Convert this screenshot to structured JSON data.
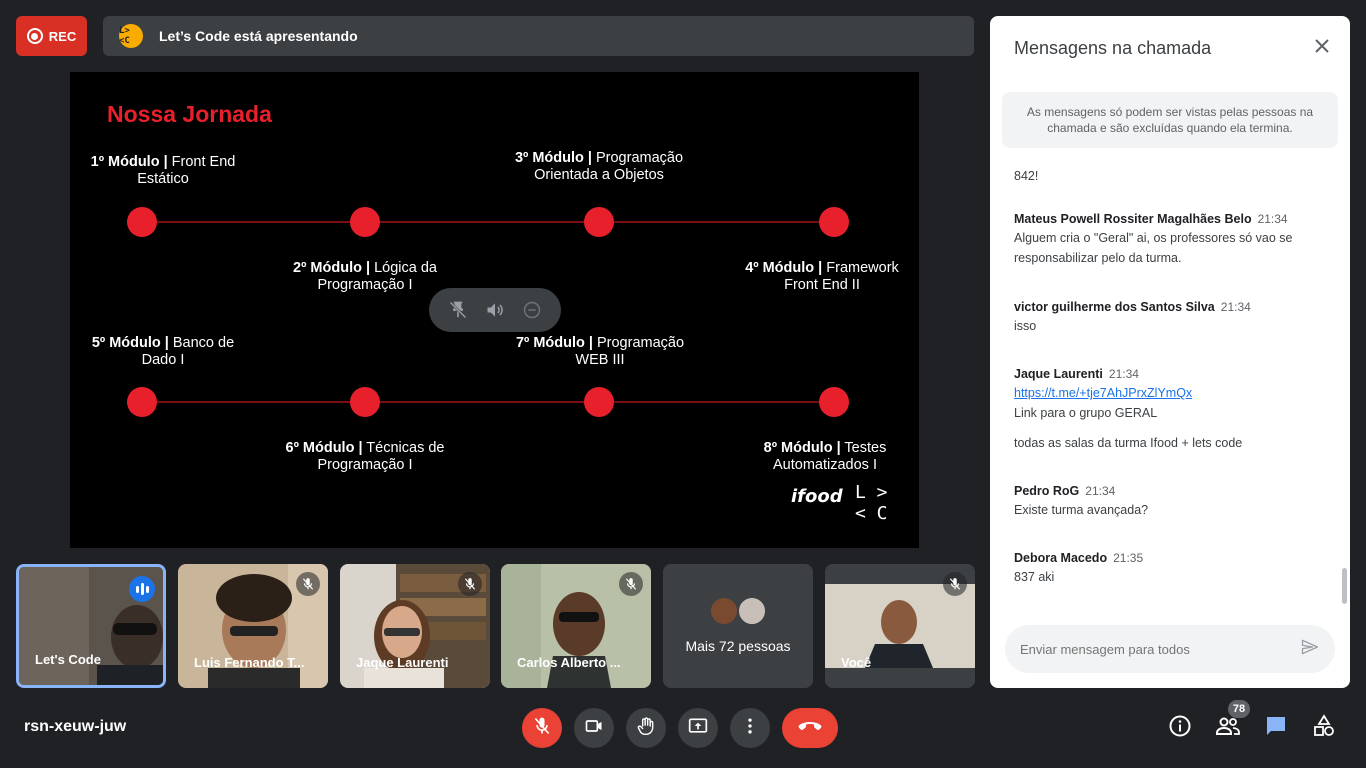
{
  "top_bar": {
    "rec_label": "REC",
    "presenting_text": "Let’s Code está apresentando",
    "presenter_logo": "L> <C"
  },
  "slide": {
    "title": "Nossa Jornada",
    "modules": [
      {
        "bold": "1º Módulo |",
        "rest": " Front End Estático"
      },
      {
        "bold": "2º Módulo |",
        "rest": " Lógica da Programação I"
      },
      {
        "bold": "3º Módulo |",
        "rest": " Programação Orientada a Objetos"
      },
      {
        "bold": "4º Módulo |",
        "rest": " Framework Front End II"
      },
      {
        "bold": "5º Módulo |",
        "rest": " Banco de Dado I"
      },
      {
        "bold": "6º Módulo |",
        "rest": " Técnicas de Programação I"
      },
      {
        "bold": "7º Módulo |",
        "rest": " Programação WEB III"
      },
      {
        "bold": "8º Módulo |",
        "rest": " Testes Automatizados I"
      }
    ],
    "brand_ifood": "ifood",
    "brand_lc_top": "L >",
    "brand_lc_bottom": "< C",
    "accent": "#e8202b"
  },
  "participants": [
    {
      "name": "Let's Code",
      "speaking": true
    },
    {
      "name": "Luis Fernando T...",
      "muted": true
    },
    {
      "name": "Jaque Laurenti",
      "muted": true
    },
    {
      "name": "Carlos Alberto ...",
      "muted": true
    },
    {
      "name": "Mais 72 pessoas"
    },
    {
      "name": "Você",
      "muted": true
    }
  ],
  "bottom_bar": {
    "meeting_code": "rsn-xeuw-juw",
    "people_count": "78"
  },
  "chat": {
    "title": "Mensagens na chamada",
    "notice": "As mensagens só podem ser vistas pelas pessoas na chamada e são excluídas quando ela termina.",
    "partial_message": "842!",
    "messages": [
      {
        "author": "Mateus Powell Rossiter Magalhães Belo",
        "time": "21:34",
        "lines": [
          "Alguem cria o \"Geral\" ai, os professores só vao se",
          "responsabilizar pelo da turma."
        ]
      },
      {
        "author": "victor guilherme dos Santos Silva",
        "time": "21:34",
        "lines": [
          "isso"
        ]
      },
      {
        "author": "Jaque Laurenti",
        "time": "21:34",
        "link": "https://t.me/+tje7AhJPrxZlYmQx",
        "lines": [
          "Link para o grupo GERAL"
        ],
        "extra": "todas as salas da turma Ifood + lets code"
      },
      {
        "author": "Pedro RoG",
        "time": "21:34",
        "lines": [
          "Existe turma avançada?"
        ]
      },
      {
        "author": "Debora Macedo",
        "time": "21:35",
        "lines": [
          "837 aki"
        ]
      }
    ],
    "input_placeholder": "Enviar mensagem para todos"
  },
  "icons": [
    "record-icon",
    "letscode-logo",
    "pin-off-icon",
    "volume-icon",
    "remove-icon",
    "mic-off-icon",
    "speaking-icon",
    "camera-icon",
    "raise-hand-icon",
    "present-icon",
    "more-icon",
    "hang-up-icon",
    "info-icon",
    "people-icon",
    "chat-icon",
    "activities-icon",
    "close-icon",
    "send-icon"
  ],
  "colors": {
    "background": "#202124",
    "red": "#ea4335",
    "blue": "#1a73e8",
    "panel": "#ffffff"
  }
}
